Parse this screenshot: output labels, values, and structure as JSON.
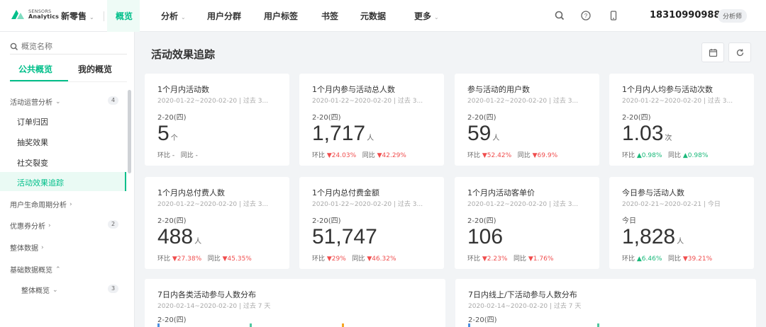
{
  "header": {
    "brand_line1": "SENSORS",
    "brand_line2": "Analytics",
    "project": "新零售",
    "nav": [
      "概览",
      "分析",
      "用户分群",
      "用户标签",
      "书签",
      "元数据",
      "更多"
    ],
    "user": "18310990988",
    "role": "分析师"
  },
  "sidebar": {
    "search_placeholder": "概览名称",
    "tabs": [
      "公共概览",
      "我的概览"
    ],
    "groups": [
      {
        "label": "活动运营分析",
        "count": "4"
      },
      {
        "label": "用户生命周期分析"
      },
      {
        "label": "优惠券分析",
        "count": "2"
      },
      {
        "label": "整体数据"
      },
      {
        "label": "基础数据概览"
      }
    ],
    "items": [
      "订单归因",
      "抽奖效果",
      "社交裂变",
      "活动效果追踪"
    ],
    "sub_group": {
      "label": "整体概览",
      "count": "3"
    }
  },
  "main": {
    "title": "活动效果追踪",
    "cards": [
      {
        "title": "1个月内活动数",
        "range": "2020-01-22~2020-02-20 | 过去 3...",
        "date": "2-20(四)",
        "value": "5",
        "unit": "个",
        "cmp1_label": "环比",
        "cmp1_value": "-",
        "cmp2_label": "同比",
        "cmp2_value": "-"
      },
      {
        "title": "1个月内参与活动总人数",
        "range": "2020-01-22~2020-02-20 | 过去 3...",
        "date": "2-20(四)",
        "value": "1,717",
        "unit": "人",
        "cmp1_label": "环比",
        "cmp1_value": "▼24.03%",
        "cmp2_label": "同比",
        "cmp2_value": "▼42.29%"
      },
      {
        "title": "参与活动的用户数",
        "range": "2020-01-22~2020-02-20 | 过去 3...",
        "date": "2-20(四)",
        "value": "59",
        "unit": "人",
        "cmp1_label": "环比",
        "cmp1_value": "▼52.42%",
        "cmp2_label": "同比",
        "cmp2_value": "▼69.9%"
      },
      {
        "title": "1个月内人均参与活动次数",
        "range": "2020-01-22~2020-02-20 | 过去 3...",
        "date": "2-20(四)",
        "value": "1.03",
        "unit": "次",
        "cmp1_label": "环比",
        "cmp1_value": "▲0.98%",
        "cmp2_label": "同比",
        "cmp2_value": "▲0.98%"
      },
      {
        "title": "1个月内总付费人数",
        "range": "2020-01-22~2020-02-20 | 过去 3...",
        "date": "2-20(四)",
        "value": "488",
        "unit": "人",
        "cmp1_label": "环比",
        "cmp1_value": "▼27.38%",
        "cmp2_label": "同比",
        "cmp2_value": "▼45.35%"
      },
      {
        "title": "1个月内总付费金额",
        "range": "2020-01-22~2020-02-20 | 过去 3...",
        "date": "2-20(四)",
        "value": "51,747",
        "unit": "",
        "cmp1_label": "环比",
        "cmp1_value": "▼29%",
        "cmp2_label": "同比",
        "cmp2_value": "▼46.32%"
      },
      {
        "title": "1个月内活动客单价",
        "range": "2020-01-22~2020-02-20 | 过去 3...",
        "date": "2-20(四)",
        "value": "106",
        "unit": "",
        "cmp1_label": "环比",
        "cmp1_value": "▼2.23%",
        "cmp2_label": "同比",
        "cmp2_value": "▼1.76%"
      },
      {
        "title": "今日参与活动人数",
        "range": "2020-02-21~2020-02-21 | 今日",
        "date": "今日",
        "value": "1,828",
        "unit": "人",
        "cmp1_label": "环比",
        "cmp1_value": "▲6.46%",
        "cmp2_label": "同比",
        "cmp2_value": "▼39.21%"
      }
    ],
    "wide_cards": [
      {
        "title": "7日内各类活动参与人数分布",
        "range": "2020-02-14~2020-02-20 | 过去 7 天",
        "date": "2-20(四)"
      },
      {
        "title": "7日内线上/下活动参与人数分布",
        "range": "2020-02-14~2020-02-20 | 过去 7 天",
        "date": "2-20(四)"
      }
    ]
  },
  "colors": {
    "accent": "#00bf8a",
    "down": "#f04d4d",
    "up": "#1ab97a"
  }
}
